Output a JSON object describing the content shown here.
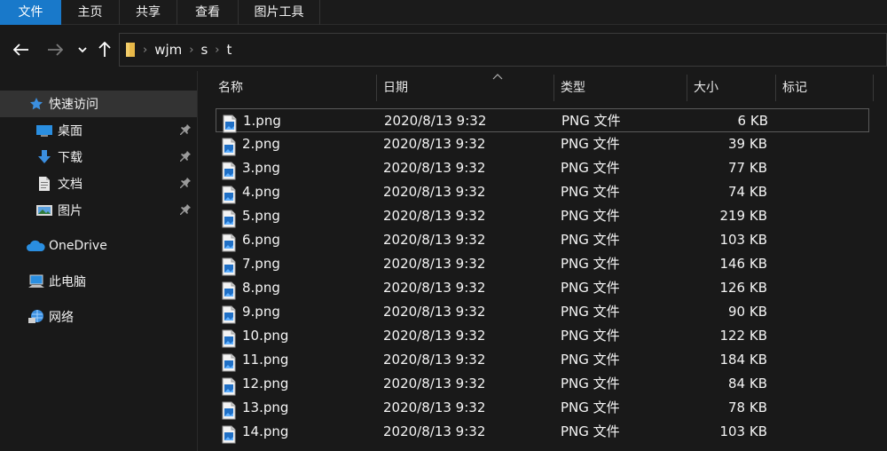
{
  "ribbon": {
    "tabs": [
      {
        "label": "文件",
        "active": true
      },
      {
        "label": "主页",
        "active": false
      },
      {
        "label": "共享",
        "active": false
      },
      {
        "label": "查看",
        "active": false
      },
      {
        "label": "图片工具",
        "active": false
      }
    ]
  },
  "address": {
    "breadcrumbs": [
      "wjm",
      "s",
      "t"
    ]
  },
  "sidebar": {
    "items": [
      {
        "label": "快速访问",
        "icon": "star-icon",
        "pinned": false
      },
      {
        "label": "桌面",
        "icon": "desktop-icon",
        "pinned": true
      },
      {
        "label": "下载",
        "icon": "download-icon",
        "pinned": true
      },
      {
        "label": "文档",
        "icon": "document-icon",
        "pinned": true
      },
      {
        "label": "图片",
        "icon": "pictures-icon",
        "pinned": true
      },
      {
        "label": "OneDrive",
        "icon": "cloud-icon",
        "pinned": false
      },
      {
        "label": "此电脑",
        "icon": "computer-icon",
        "pinned": false
      },
      {
        "label": "网络",
        "icon": "network-icon",
        "pinned": false
      }
    ]
  },
  "columns": {
    "name": "名称",
    "date": "日期",
    "type": "类型",
    "size": "大小",
    "tags": "标记"
  },
  "files": [
    {
      "name": "1.png",
      "date": "2020/8/13 9:32",
      "type": "PNG 文件",
      "size": "6 KB"
    },
    {
      "name": "2.png",
      "date": "2020/8/13 9:32",
      "type": "PNG 文件",
      "size": "39 KB"
    },
    {
      "name": "3.png",
      "date": "2020/8/13 9:32",
      "type": "PNG 文件",
      "size": "77 KB"
    },
    {
      "name": "4.png",
      "date": "2020/8/13 9:32",
      "type": "PNG 文件",
      "size": "74 KB"
    },
    {
      "name": "5.png",
      "date": "2020/8/13 9:32",
      "type": "PNG 文件",
      "size": "219 KB"
    },
    {
      "name": "6.png",
      "date": "2020/8/13 9:32",
      "type": "PNG 文件",
      "size": "103 KB"
    },
    {
      "name": "7.png",
      "date": "2020/8/13 9:32",
      "type": "PNG 文件",
      "size": "146 KB"
    },
    {
      "name": "8.png",
      "date": "2020/8/13 9:32",
      "type": "PNG 文件",
      "size": "126 KB"
    },
    {
      "name": "9.png",
      "date": "2020/8/13 9:32",
      "type": "PNG 文件",
      "size": "90 KB"
    },
    {
      "name": "10.png",
      "date": "2020/8/13 9:32",
      "type": "PNG 文件",
      "size": "122 KB"
    },
    {
      "name": "11.png",
      "date": "2020/8/13 9:32",
      "type": "PNG 文件",
      "size": "184 KB"
    },
    {
      "name": "12.png",
      "date": "2020/8/13 9:32",
      "type": "PNG 文件",
      "size": "84 KB"
    },
    {
      "name": "13.png",
      "date": "2020/8/13 9:32",
      "type": "PNG 文件",
      "size": "78 KB"
    },
    {
      "name": "14.png",
      "date": "2020/8/13 9:32",
      "type": "PNG 文件",
      "size": "103 KB"
    }
  ],
  "colors": {
    "background": "#191919",
    "accent": "#1979ca",
    "selected": "#333333"
  }
}
